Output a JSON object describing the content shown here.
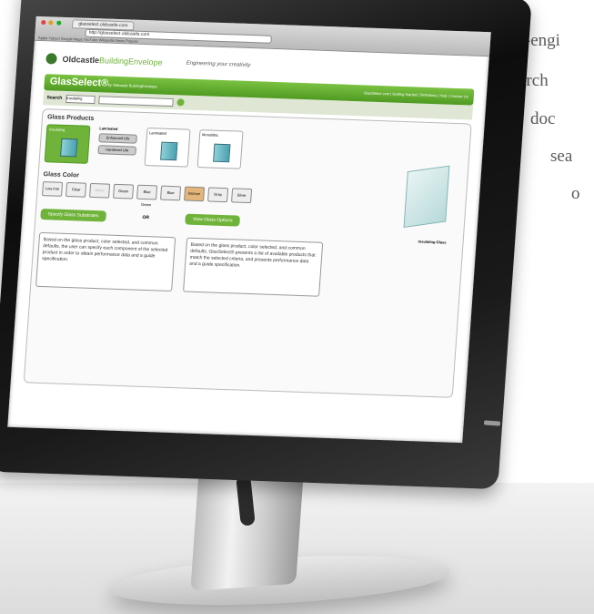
{
  "side_text": [
    "custom-engi",
    "arch",
    "doc",
    "sea",
    "o"
  ],
  "browser": {
    "tab_title": "glasselect.oldcastle.com",
    "address": "http://glasselect.oldcastle.com",
    "bookmarks": "Apple  Yahoo!  Google Maps  YouTube  Wikipedia  News  Popular"
  },
  "site": {
    "brand_prefix": "Oldcastle",
    "brand_suffix": "BuildingEnvelope",
    "tagline": "Engineering your creativity",
    "app_title": "GlasSelect®",
    "app_subtitle": "by Oldcastle BuildingEnvelope",
    "nav_links": "GlasSelect.com | Getting Started | Definitions | Help | Contact Us",
    "search_label": "Search",
    "search_select": "Insulating",
    "search_placeholder": ""
  },
  "products": {
    "heading": "Glass Products",
    "insulating_label": "Insulating",
    "laminated_label": "Laminated",
    "lam_opt1": "Enhanced Life",
    "lam_opt2": "Hardened Life",
    "laminated2_label": "Laminated",
    "monolithic_label": "Monolithic",
    "big_caption": "Insulating Glass"
  },
  "color": {
    "heading": "Glass Color",
    "options": [
      "Low Iron",
      "Clear",
      "White",
      "Green",
      "Blue Green",
      "Blue",
      "Bronze",
      "Gray",
      "Silver"
    ]
  },
  "actions": {
    "specify": "Specify Glass Substrates",
    "or": "OR",
    "view": "View Glass Options"
  },
  "descriptions": {
    "left": "Based on the glass product, color selected, and common defaults, the user can specify each component of the selected product in order to obtain performance data and a guide specification.",
    "right": "Based on the glass product, color selected, and common defaults, GlasSelect® presents a list of available products that match the selected criteria, and presents performance data and a guide specification."
  }
}
